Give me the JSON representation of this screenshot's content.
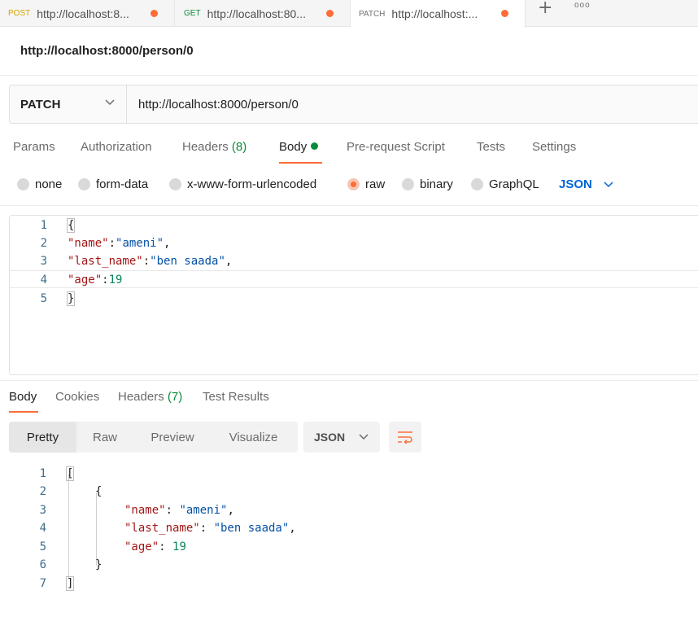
{
  "tabs": [
    {
      "method": "POST",
      "url": "http://localhost:8..."
    },
    {
      "method": "GET",
      "url": "http://localhost:80..."
    },
    {
      "method": "PATCH",
      "url": "http://localhost:..."
    }
  ],
  "tab_actions": {
    "new_tab": "+",
    "more": "ooo"
  },
  "request": {
    "title": "http://localhost:8000/person/0",
    "method": "PATCH",
    "url": "http://localhost:8000/person/0"
  },
  "request_tabs": {
    "params": "Params",
    "authorization": "Authorization",
    "headers_label": "Headers",
    "headers_count": "(8)",
    "body": "Body",
    "pre_request": "Pre-request Script",
    "tests": "Tests",
    "settings": "Settings"
  },
  "body_types": {
    "none": "none",
    "form_data": "form-data",
    "urlencoded": "x-www-form-urlencoded",
    "raw": "raw",
    "binary": "binary",
    "graphql": "GraphQL",
    "language": "JSON"
  },
  "request_body": {
    "line_numbers": [
      "1",
      "2",
      "3",
      "4",
      "5"
    ],
    "line1_open": "{",
    "name_key": "\"name\"",
    "colon": ":",
    "name_value": "\"ameni\"",
    "comma": ",",
    "last_name_key": "\"last_name\"",
    "last_name_value": "\"ben saada\"",
    "age_key": "\"age\"",
    "age_value": "19",
    "line5_close": "}"
  },
  "response_tabs": {
    "body": "Body",
    "cookies": "Cookies",
    "headers_label": "Headers",
    "headers_count": "(7)",
    "test_results": "Test Results"
  },
  "response_view": {
    "pretty": "Pretty",
    "raw": "Raw",
    "preview": "Preview",
    "visualize": "Visualize",
    "format": "JSON"
  },
  "response_body": {
    "line_numbers": [
      "1",
      "2",
      "3",
      "4",
      "5",
      "6",
      "7"
    ],
    "open_bracket": "[",
    "open_brace": "{",
    "name_key": "\"name\"",
    "name_value": "\"ameni\"",
    "last_name_key": "\"last_name\"",
    "last_name_value": "\"ben saada\"",
    "age_key": "\"age\"",
    "age_value": "19",
    "close_brace": "}",
    "close_bracket": "]",
    "colon_space": ": ",
    "comma": ","
  },
  "colors": {
    "accent": "#ff6c37",
    "green": "#0b8a3b",
    "link_blue": "#0265d2"
  }
}
